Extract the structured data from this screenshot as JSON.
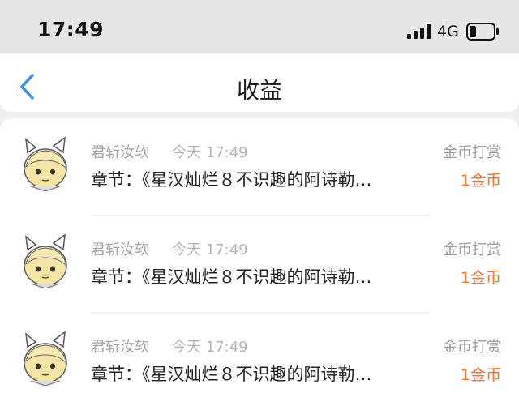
{
  "status_bar": {
    "time": "17:49",
    "network": "4G",
    "icons": [
      "signal-icon",
      "battery-icon"
    ]
  },
  "nav": {
    "back_icon": "chevron-left-icon",
    "title": "收益"
  },
  "colors": {
    "accent": "#3b8ff0",
    "amount": "#f2752b",
    "secondary_text": "#a3a3a3"
  },
  "items": [
    {
      "sender": "君斩汝软",
      "time": "今天 17:49",
      "content": "章节：《星汉灿烂８不识趣的阿诗勒…",
      "type": "金币打赏",
      "amount": "1金币"
    },
    {
      "sender": "君斩汝软",
      "time": "今天 17:49",
      "content": "章节：《星汉灿烂８不识趣的阿诗勒…",
      "type": "金币打赏",
      "amount": "1金币"
    },
    {
      "sender": "君斩汝软",
      "time": "今天 17:49",
      "content": "章节：《星汉灿烂８不识趣的阿诗勒…",
      "type": "金币打赏",
      "amount": "1金币"
    }
  ]
}
